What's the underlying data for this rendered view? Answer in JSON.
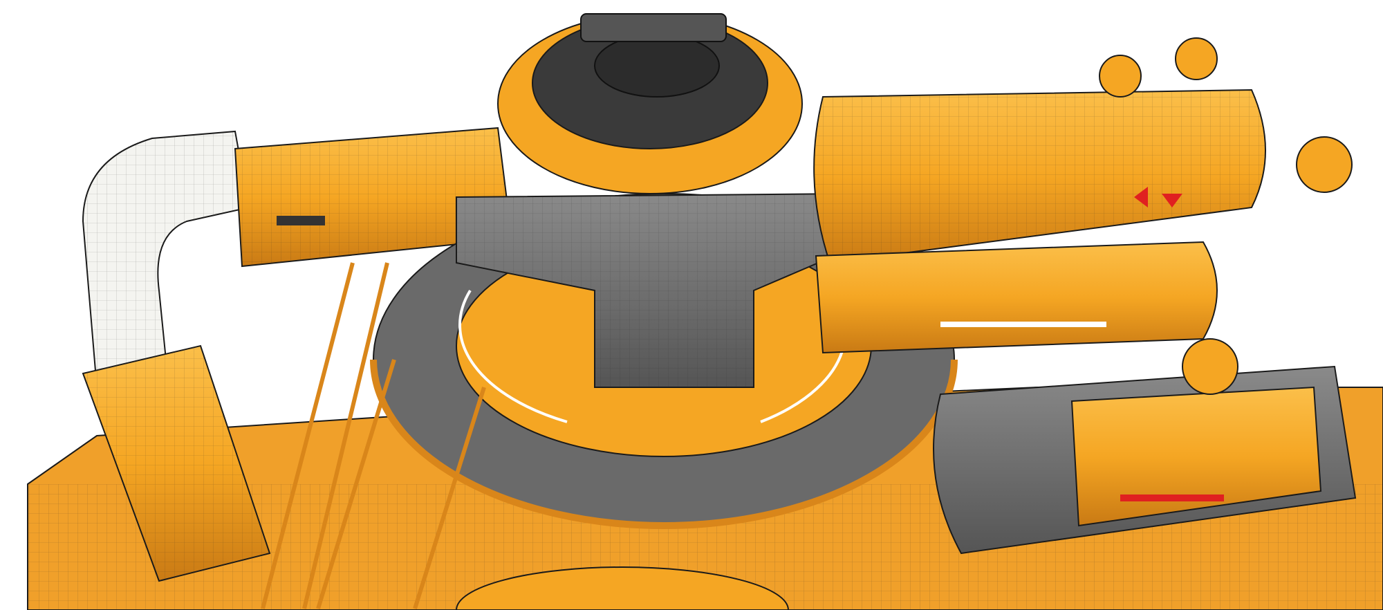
{
  "scene": {
    "subject": "industrial-machinery-render",
    "colors": {
      "background": "#ffffff",
      "orange": "#f5a623",
      "orange_dark": "#d9861a",
      "orange_light": "#fbbf4a",
      "grey": "#6e6e6e",
      "grey_dark": "#3a3a3a",
      "grey_light": "#8a8a8a",
      "pipe_white": "#f4f4f0",
      "outline": "#1a1a1a",
      "accent_red": "#e02020"
    }
  }
}
